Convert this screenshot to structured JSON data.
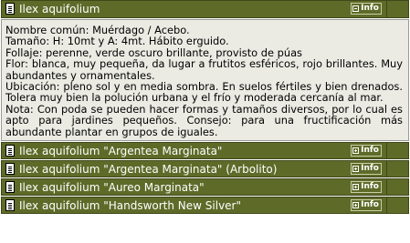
{
  "info_label": "Info",
  "items": [
    {
      "title": "Ilex aquifolium",
      "expanded": true
    },
    {
      "title": "Ilex aquifolium \"Argentea Marginata\"",
      "expanded": false
    },
    {
      "title": "Ilex aquifolium \"Argentea Marginata\" (Arbolito)",
      "expanded": false
    },
    {
      "title": "Ilex aquifolium \"Aureo Marginata\"",
      "expanded": false
    },
    {
      "title": "Ilex aquifolium \"Handsworth New Silver\"",
      "expanded": false
    }
  ],
  "detail": {
    "nombre": "Nombre común: Muérdago / Acebo.",
    "tamano": "Tamaño: H: 10mt y A: 4mt. Hábito erguido.",
    "follaje": "Follaje: perenne, verde oscuro brillante, provisto de púas",
    "flor": "Flor: blanca, muy pequeña, da lugar a frutitos esféricos, rojo brillantes. Muy abundantes y ornamentales.",
    "ubicacion": "Ubicación: pleno sol y en media sombra. En suelos fértiles y bien drenados. Tolera muy bien la polución urbana y el frío y moderada cercanía al mar.",
    "nota": "Nota: Con poda se pueden hacer formas y tamaños diversos, por lo cual es apto para jardines pequeños. Consejo: para una fructificación más abundante plantar en grupos de iguales."
  },
  "colors": {
    "header_bg": "#5e6a28",
    "header_border": "#3f4717",
    "detail_bg": "#ebebe4"
  }
}
